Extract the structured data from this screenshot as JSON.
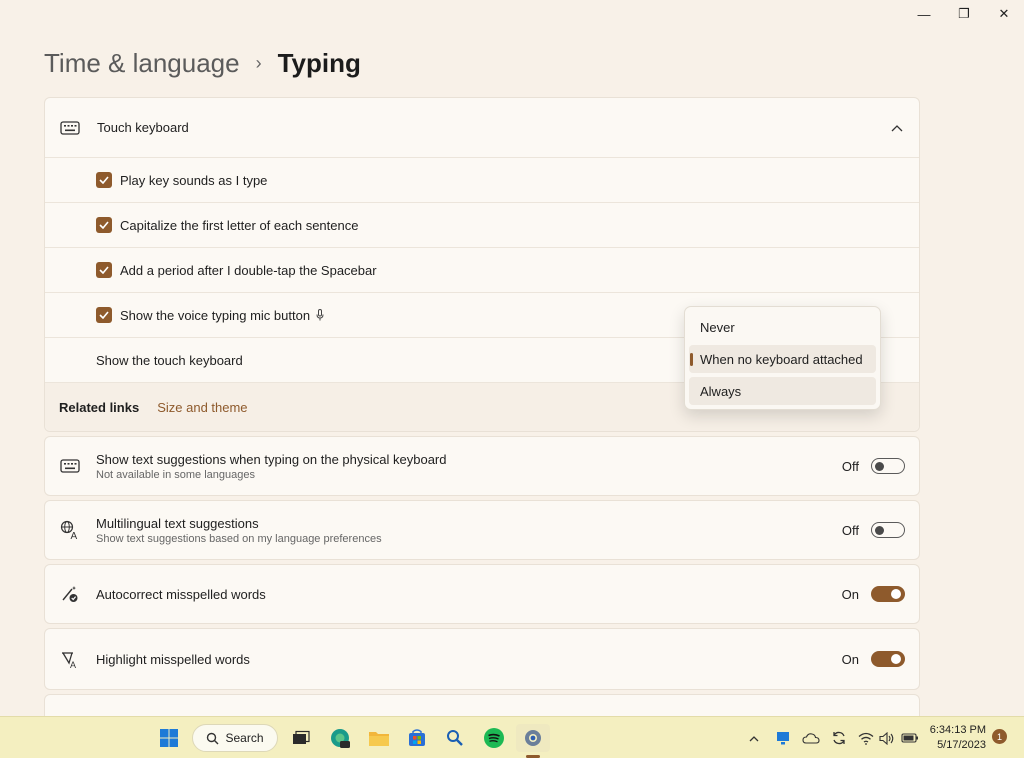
{
  "window": {
    "minimize": "—",
    "maximize": "❐",
    "close": "✕"
  },
  "breadcrumb": {
    "parent": "Time & language",
    "separator": "›",
    "current": "Typing"
  },
  "touch_keyboard": {
    "title": "Touch keyboard",
    "options": [
      {
        "label": "Play key sounds as I type",
        "checked": true
      },
      {
        "label": "Capitalize the first letter of each sentence",
        "checked": true
      },
      {
        "label": "Add a period after I double-tap the Spacebar",
        "checked": true
      },
      {
        "label": "Show the voice typing mic button",
        "checked": true
      }
    ],
    "show_touch_keyboard_label": "Show the touch keyboard",
    "related_links_label": "Related links",
    "related_link": "Size and theme"
  },
  "dropdown": {
    "options": [
      "Never",
      "When no keyboard attached",
      "Always"
    ],
    "selected": "When no keyboard attached"
  },
  "settings": [
    {
      "title": "Show text suggestions when typing on the physical keyboard",
      "subtitle": "Not available in some languages",
      "state": "Off",
      "on": false,
      "icon": "keyboard-icon"
    },
    {
      "title": "Multilingual text suggestions",
      "subtitle": "Show text suggestions based on my language preferences",
      "state": "Off",
      "on": false,
      "icon": "language-icon"
    },
    {
      "title": "Autocorrect misspelled words",
      "subtitle": "",
      "state": "On",
      "on": true,
      "icon": "autocorrect-icon"
    },
    {
      "title": "Highlight misspelled words",
      "subtitle": "",
      "state": "On",
      "on": true,
      "icon": "highlight-text-icon"
    }
  ],
  "taskbar": {
    "search_label": "Search",
    "time": "6:34:13 PM",
    "date": "5/17/2023",
    "notification_count": "1"
  },
  "colors": {
    "accent": "#8e5a2c",
    "background": "#f8f1e8",
    "taskbar": "#f4efc0"
  }
}
